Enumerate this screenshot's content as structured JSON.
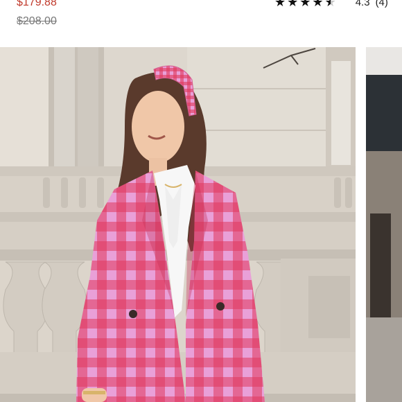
{
  "listing": {
    "price": "$179.88",
    "original_price": "$208.00"
  },
  "rating": {
    "score": "4.3",
    "count": "(4)",
    "stars_filled": 4.3,
    "max_stars": 5
  },
  "colors": {
    "sale_price": "#c0392b",
    "star": "#111111"
  }
}
